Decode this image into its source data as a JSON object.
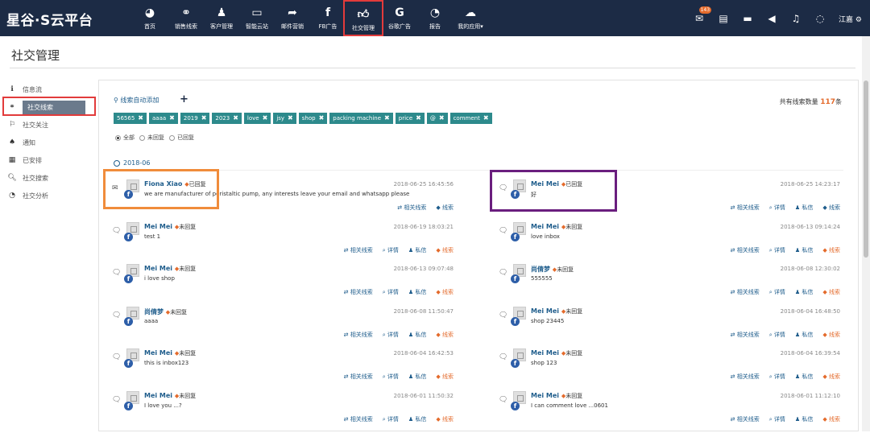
{
  "brand": {
    "logo": "星谷·S云平台",
    "nav_bg": "#1c2b45",
    "accent": "#e46b2c",
    "tag_color": "#2d8a8c"
  },
  "nav": {
    "items": [
      {
        "label": "首页",
        "icon": "dashboard-icon"
      },
      {
        "label": "销售线索",
        "icon": "link-icon"
      },
      {
        "label": "客户管理",
        "icon": "user-icon"
      },
      {
        "label": "智能云站",
        "icon": "monitor-icon"
      },
      {
        "label": "邮件营销",
        "icon": "share-icon"
      },
      {
        "label": "FB广告",
        "icon": "facebook-icon"
      },
      {
        "label": "社交管理",
        "icon": "thumbs-up-icon",
        "active": true
      },
      {
        "label": "谷歌广告",
        "icon": "google-icon"
      },
      {
        "label": "报告",
        "icon": "pie-chart-icon"
      },
      {
        "label": "我的应用▾",
        "icon": "cloud-icon"
      }
    ],
    "mail_badge": "143",
    "user": "江嘉"
  },
  "page_title": "社交管理",
  "sidebar": {
    "items": [
      {
        "label": "信息流",
        "icon": "info-icon"
      },
      {
        "label": "社交线索",
        "icon": "link-icon",
        "active": true
      },
      {
        "label": "社交关注",
        "icon": "flag-icon"
      },
      {
        "label": "通知",
        "icon": "bell-icon"
      },
      {
        "label": "已安排",
        "icon": "calendar-icon"
      },
      {
        "label": "社交搜索",
        "icon": "search-icon"
      },
      {
        "label": "社交分析",
        "icon": "pie-chart-icon"
      }
    ]
  },
  "filters": {
    "auto_add_label": "线索自动添加",
    "total_prefix": "共有线索数量",
    "total_count": "117",
    "total_suffix": "条",
    "tags": [
      "56565",
      "aaaa",
      "2019",
      "2023",
      "love",
      "jsy",
      "shop",
      "packing machine",
      "price",
      "@",
      "comment"
    ],
    "radios": [
      {
        "label": "全部",
        "checked": true
      },
      {
        "label": "未回复",
        "checked": false
      },
      {
        "label": "已回复",
        "checked": false
      }
    ]
  },
  "feed": {
    "date_header": "2018-06",
    "actions": {
      "related": "相关线索",
      "detail": "详情",
      "dm": "私信",
      "leads": "线索"
    },
    "items": [
      {
        "name": "Fiona Xiao",
        "status": "已回复",
        "time": "2018-06-25 16:45:56",
        "message": "we are manufacturer of peristaltic pump, any interests leave your email and whatsapp please",
        "icon": "envelope-icon",
        "has_detail": false
      },
      {
        "name": "Mei Mei",
        "status": "已回复",
        "time": "2018-06-25 14:23:17",
        "message": "好",
        "icon": "comment-icon",
        "has_detail": true
      },
      {
        "name": "Mei Mei",
        "status": "未回复",
        "time": "2018-06-19 18:03:21",
        "message": "test 1",
        "icon": "comment-icon",
        "has_detail": true
      },
      {
        "name": "Mei Mei",
        "status": "未回复",
        "time": "2018-06-13 09:14:24",
        "message": "love inbox",
        "icon": "comment-icon",
        "has_detail": true
      },
      {
        "name": "Mei Mei",
        "status": "未回复",
        "time": "2018-06-13 09:07:48",
        "message": "i love shop",
        "icon": "comment-icon",
        "has_detail": true
      },
      {
        "name": "尚倩梦",
        "status": "未回复",
        "time": "2018-06-08 12:30:02",
        "message": "555555",
        "icon": "comment-icon",
        "has_detail": true
      },
      {
        "name": "尚倩梦",
        "status": "未回复",
        "time": "2018-06-08 11:50:47",
        "message": "aaaa",
        "icon": "comment-icon",
        "has_detail": true
      },
      {
        "name": "Mei Mei",
        "status": "未回复",
        "time": "2018-06-04 16:48:50",
        "message": "shop 23445",
        "icon": "comment-icon",
        "has_detail": true
      },
      {
        "name": "Mei Mei",
        "status": "未回复",
        "time": "2018-06-04 16:42:53",
        "message": "this is inbox123",
        "icon": "comment-icon",
        "has_detail": true
      },
      {
        "name": "Mei Mei",
        "status": "未回复",
        "time": "2018-06-04 16:39:54",
        "message": "shop 123",
        "icon": "comment-icon",
        "has_detail": true
      },
      {
        "name": "Mei Mei",
        "status": "未回复",
        "time": "2018-06-01 11:50:32",
        "message": "I love you ...?",
        "icon": "comment-icon",
        "has_detail": true
      },
      {
        "name": "Mei Mei",
        "status": "未回复",
        "time": "2018-06-01 11:12:10",
        "message": "I can comment love ...0601",
        "icon": "comment-icon",
        "has_detail": true
      }
    ]
  }
}
